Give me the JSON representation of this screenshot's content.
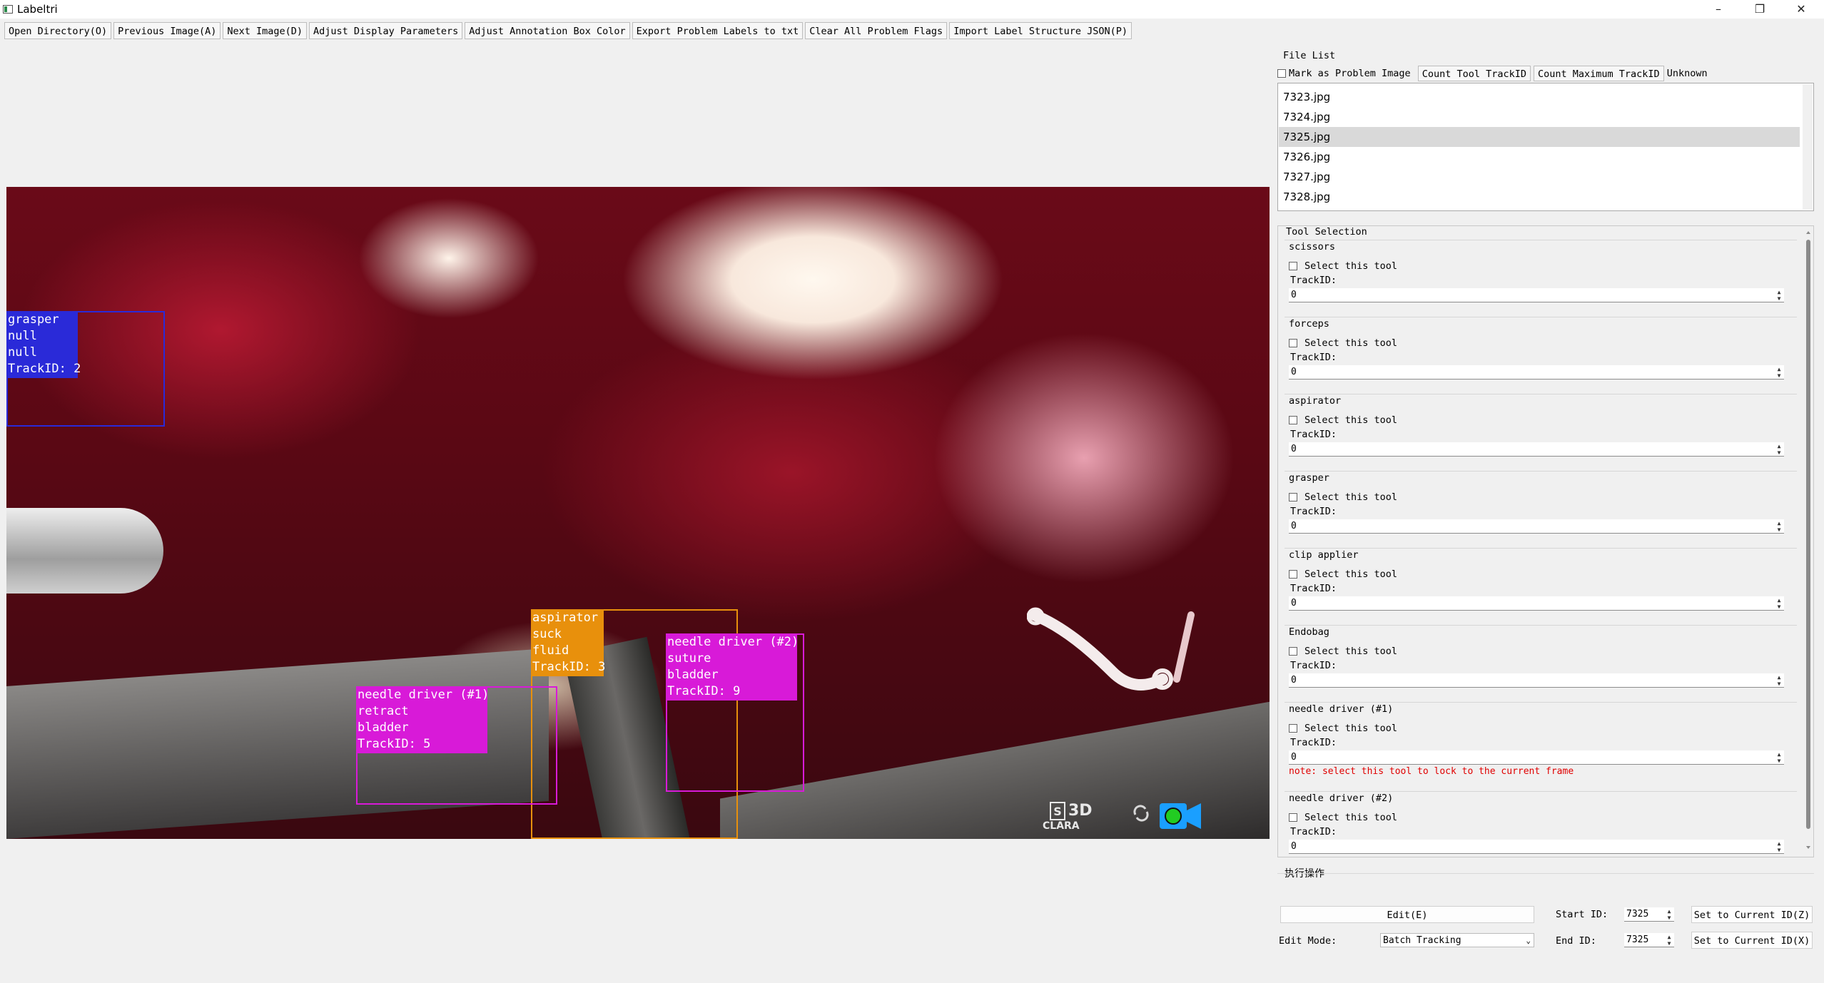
{
  "window": {
    "title": "Labeltri",
    "controls": [
      "–",
      "❐",
      "✕"
    ]
  },
  "toolbar": {
    "buttons": [
      "Open Directory(O)",
      "Previous Image(A)",
      "Next Image(D)",
      "Adjust Display Parameters",
      "Adjust Annotation Box Color",
      "Export Problem Labels to txt",
      "Clear All Problem Flags",
      "Import Label Structure JSON(P)"
    ]
  },
  "annotations": [
    {
      "lines": "grasper\nnull\nnull\nTrackID: 2",
      "color": "#2a2ad8"
    },
    {
      "lines": "aspirator\nsuck\nfluid\nTrackID: 3",
      "color": "#e8900c"
    },
    {
      "lines": "needle driver (#2)\nsuture\nbladder\nTrackID: 9",
      "color": "#d81ad8"
    },
    {
      "lines": "needle driver (#1)\nretract\nbladder\nTrackID: 5",
      "color": "#d81ad8"
    }
  ],
  "overlay": {
    "logo_3d": "3D",
    "logo_brand": "CLARA",
    "logo_s": "S"
  },
  "file_list": {
    "title": "File List",
    "mark_problem_label": "Mark as Problem Image",
    "count_button": "Count Tool TrackID",
    "max_button": "Count Maximum TrackID",
    "unknown_label": "Unknown",
    "files": [
      "7323.jpg",
      "7324.jpg",
      "7325.jpg",
      "7326.jpg",
      "7327.jpg",
      "7328.jpg"
    ],
    "selected": "7325.jpg"
  },
  "tool_selection": {
    "title": "Tool Selection",
    "select_label": "Select this tool",
    "trackid_label": "TrackID:",
    "tools": [
      {
        "name": "scissors",
        "trackid": "0"
      },
      {
        "name": "forceps",
        "trackid": "0"
      },
      {
        "name": "aspirator",
        "trackid": "0"
      },
      {
        "name": "grasper",
        "trackid": "0"
      },
      {
        "name": "clip applier",
        "trackid": "0"
      },
      {
        "name": "Endobag",
        "trackid": "0"
      },
      {
        "name": "needle driver (#1)",
        "trackid": "0"
      },
      {
        "name": "needle driver (#2)",
        "trackid": "0"
      }
    ],
    "note": "note: select this tool to lock to the current frame"
  },
  "actions": {
    "title": "执行操作",
    "edit_button": "Edit(E)",
    "start_id_label": "Start ID:",
    "start_id_value": "7325",
    "set_start_button": "Set to Current ID(Z)",
    "edit_mode_label": "Edit Mode:",
    "edit_mode_value": "Batch Tracking",
    "end_id_label": "End ID:",
    "end_id_value": "7325",
    "set_end_button": "Set to Current ID(X)"
  }
}
